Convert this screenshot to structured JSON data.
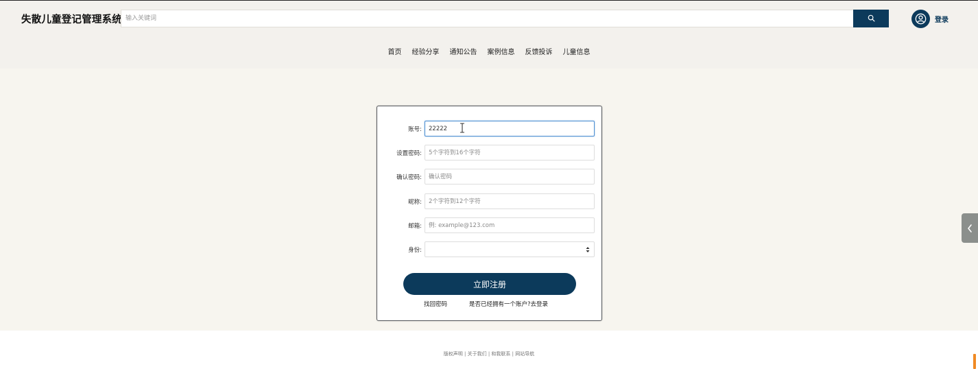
{
  "header": {
    "site_title": "失散儿童登记管理系统",
    "search_placeholder": "输入关键词",
    "login_label": "登录"
  },
  "nav": {
    "items": [
      "首页",
      "经验分享",
      "通知公告",
      "案例信息",
      "反馈投诉",
      "儿童信息"
    ]
  },
  "form": {
    "fields": [
      {
        "label": "账号:",
        "value": "22222",
        "placeholder": ""
      },
      {
        "label": "设置密码:",
        "value": "",
        "placeholder": "5个字符到16个字符"
      },
      {
        "label": "确认密码:",
        "value": "",
        "placeholder": "确认密码"
      },
      {
        "label": "昵称:",
        "value": "",
        "placeholder": "2个字符到12个字符"
      },
      {
        "label": "邮箱:",
        "value": "",
        "placeholder": "例: example@123.com"
      },
      {
        "label": "身份:",
        "value": "",
        "placeholder": ""
      }
    ],
    "register_button": "立即注册",
    "forgot_password": "找回密码",
    "have_account": "是否已经拥有一个账户?去登录"
  },
  "footer": {
    "links": "版权声明 | 关于我们 | 和我联系 | 网站导航"
  },
  "icons": {
    "search": "search-icon",
    "user": "user-icon",
    "side_tab": "chevron-left-icon"
  },
  "colors": {
    "primary": "#0c3a5b",
    "header_bg": "#f3f1ed",
    "main_bg": "#f7f5ef",
    "focus_border": "#4c8ed2",
    "side_tab": "#8b8f8c"
  }
}
